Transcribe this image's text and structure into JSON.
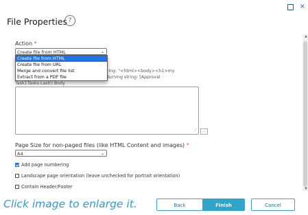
{
  "window": {
    "maximize_icon": "maximize-icon",
    "close_label": "×"
  },
  "header": {
    "title": "File Properties",
    "help_label": "?"
  },
  "action": {
    "label": "Action",
    "required_mark": "*",
    "selected": "Create file from HTML",
    "options": [
      "Create file from HTML",
      "Create file from URL",
      "Merge and convert file list",
      "Extract from a PDF file"
    ]
  },
  "partial_text": {
    "line1": "string: \"<html><body><h1>my",
    "line2": "returning string: [Approval",
    "line3": "Task].Tasks.Last().Body"
  },
  "html_content": {
    "ellipsis_label": "..."
  },
  "page_size": {
    "label": "Page Size for non-paged files (like HTML Content and images)",
    "required_mark": "*",
    "selected": "A4"
  },
  "options": {
    "page_numbering": {
      "label": "Add page numbering",
      "checked": true
    },
    "landscape": {
      "label": "Landscape page orientation (leave unchecked for portrait orientation)",
      "checked": false
    },
    "header_footer": {
      "label": "Contain Header/Footer",
      "checked": false
    }
  },
  "caption": "Click image to enlarge it.",
  "footer": {
    "back_label": "Back",
    "finish_label": "Finish",
    "cancel_label": "Cancel"
  }
}
